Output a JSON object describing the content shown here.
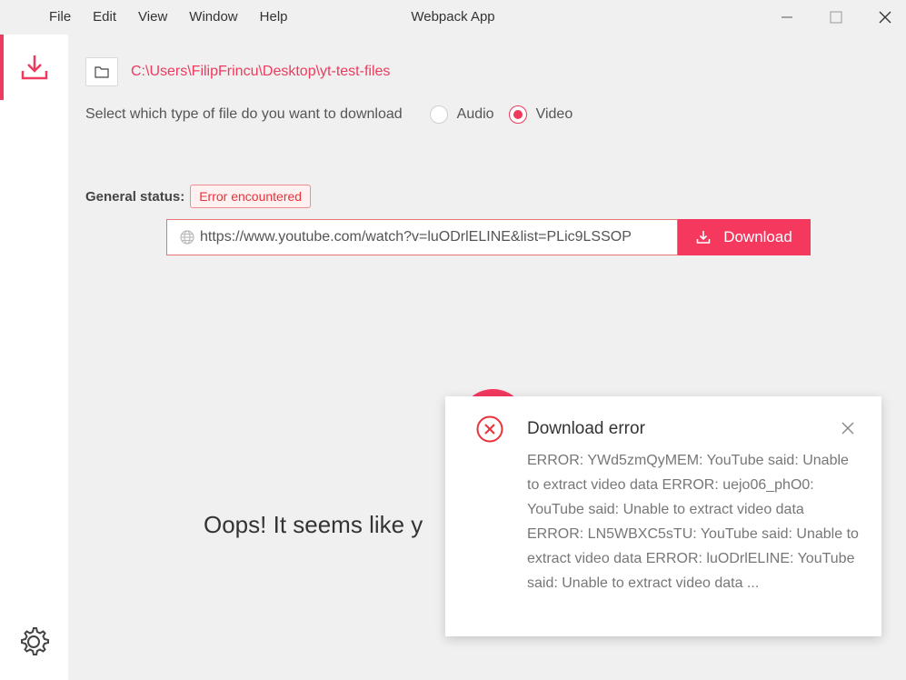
{
  "window": {
    "title": "Webpack App",
    "menu": [
      "File",
      "Edit",
      "View",
      "Window",
      "Help"
    ]
  },
  "sidebar": {
    "items": [
      {
        "name": "download",
        "icon": "download-icon",
        "active": true
      },
      {
        "name": "settings",
        "icon": "gear-icon",
        "active": false
      }
    ]
  },
  "main": {
    "folder_path": "C:\\Users\\FilipFrincu\\Desktop\\yt-test-files",
    "type_prompt": "Select which type of file do you want to download",
    "options": [
      {
        "label": "Audio",
        "checked": false
      },
      {
        "label": "Video",
        "checked": true
      }
    ],
    "status_label": "General status:",
    "status_value": "Error encountered",
    "url_value": "https://www.youtube.com/watch?v=luODrlELINE&list=PLic9LSSOP",
    "download_label": "Download",
    "empty_message": "Oops! It seems like y"
  },
  "notification": {
    "title": "Download error",
    "body": "ERROR: YWd5zmQyMEM: YouTube said: Unable to extract video data ERROR: uejo06_phO0: YouTube said: Unable to extract video data ERROR: LN5WBXC5sTU: YouTube said: Unable to extract video data ERROR: luODrlELINE: YouTube said: Unable to extract video data ..."
  },
  "colors": {
    "accent": "#ee3a5e",
    "error": "#e8323c",
    "background": "#f0f0f0"
  }
}
